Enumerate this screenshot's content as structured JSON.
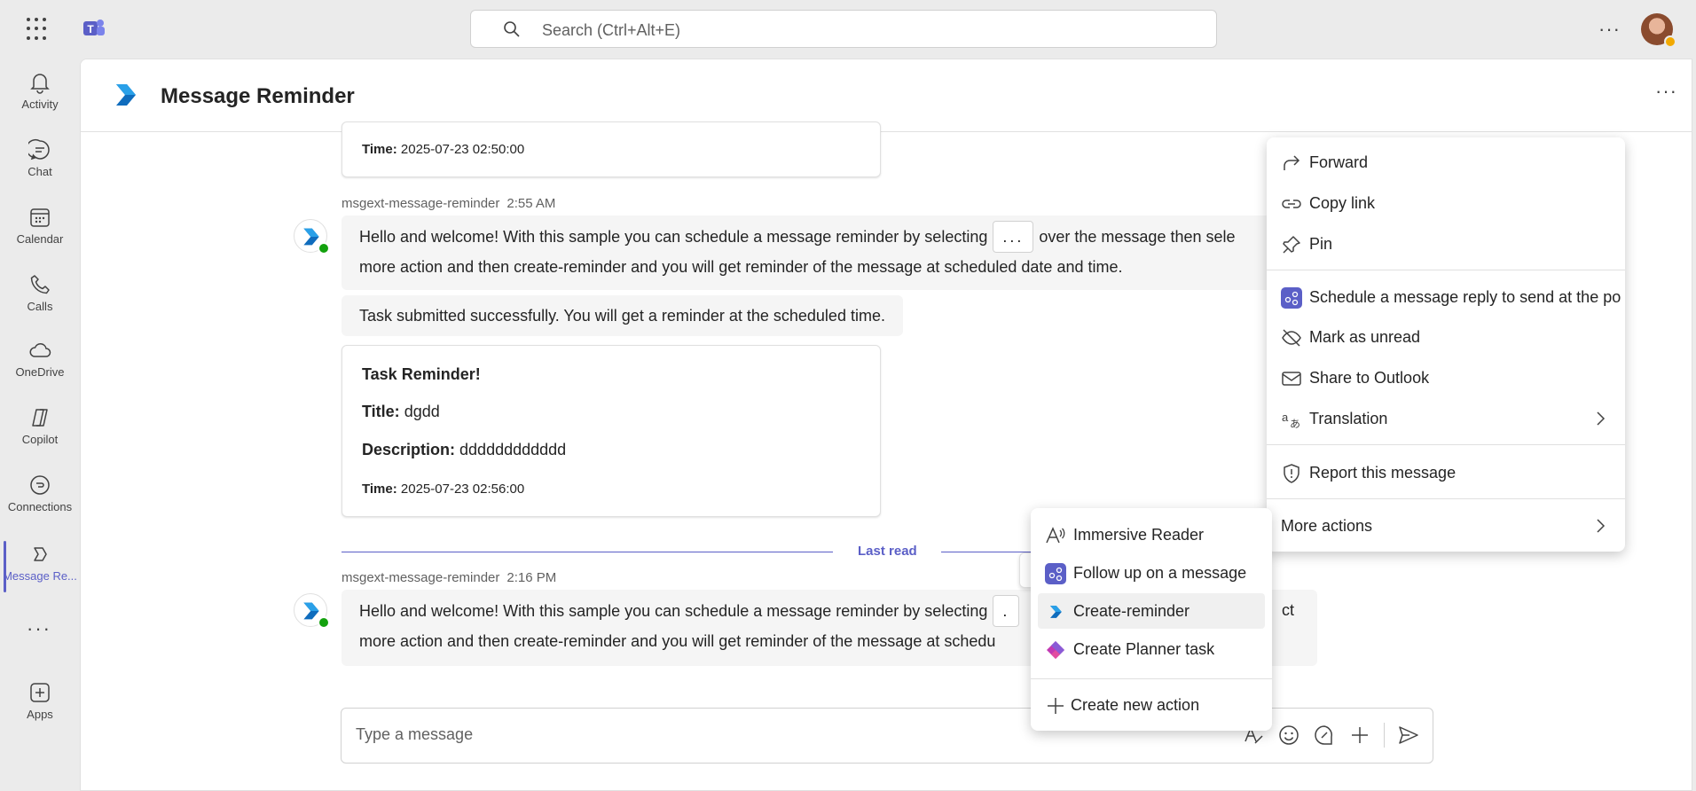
{
  "topbar": {
    "search_placeholder": "Search (Ctrl+Alt+E)",
    "more": "···"
  },
  "rail": {
    "items": [
      {
        "label": "Activity"
      },
      {
        "label": "Chat"
      },
      {
        "label": "Calendar"
      },
      {
        "label": "Calls"
      },
      {
        "label": "OneDrive"
      },
      {
        "label": "Copilot"
      },
      {
        "label": "Connections"
      },
      {
        "label": "Message Re..."
      },
      {
        "label": "Apps"
      }
    ],
    "more": "···"
  },
  "header": {
    "title": "Message Reminder",
    "more": "···"
  },
  "chat": {
    "top_card": {
      "time_label": "Time:",
      "time_value": "2025-07-23 02:50:00"
    },
    "msg1": {
      "sender": "msgext-message-reminder",
      "time": "2:55 AM",
      "text_a": "Hello and welcome! With this sample you can schedule a message reminder by selecting",
      "kbd": "...",
      "text_b": "over the message then sele",
      "text_c": "more action and then create-reminder and you will get reminder of the message at scheduled date and time."
    },
    "submitted": "Task submitted successfully. You will get a reminder at the scheduled time.",
    "reminder_card": {
      "heading": "Task Reminder!",
      "title_label": "Title:",
      "title_value": "dgdd",
      "desc_label": "Description:",
      "desc_value": "dddddddddddd",
      "time_label": "Time:",
      "time_value": "2025-07-23 02:56:00"
    },
    "last_read": "Last read",
    "msg2": {
      "sender": "msgext-message-reminder",
      "time": "2:16 PM",
      "text_a": "Hello and welcome! With this sample you can schedule a message reminder by selecting",
      "kbd": ".",
      "text_b": "ct",
      "text_c": "more action and then create-reminder and you will get reminder of the message at schedu"
    },
    "msgbar_more": "•••"
  },
  "composer": {
    "placeholder": "Type a message"
  },
  "context_menu": {
    "items": [
      {
        "label": "Forward"
      },
      {
        "label": "Copy link"
      },
      {
        "label": "Pin"
      },
      {
        "label": "Schedule a message reply to send at the po"
      },
      {
        "label": "Mark as unread"
      },
      {
        "label": "Share to Outlook"
      },
      {
        "label": "Translation"
      },
      {
        "label": "Report this message"
      },
      {
        "label": "More actions"
      }
    ]
  },
  "submenu": {
    "items": [
      {
        "label": "Immersive Reader"
      },
      {
        "label": "Follow up on a message"
      },
      {
        "label": "Create-reminder"
      },
      {
        "label": "Create Planner task"
      },
      {
        "label": "Create new action"
      }
    ]
  },
  "colors": {
    "accent": "#5b5fc7",
    "rail_bg": "#ebebeb",
    "online": "#13a10e"
  }
}
